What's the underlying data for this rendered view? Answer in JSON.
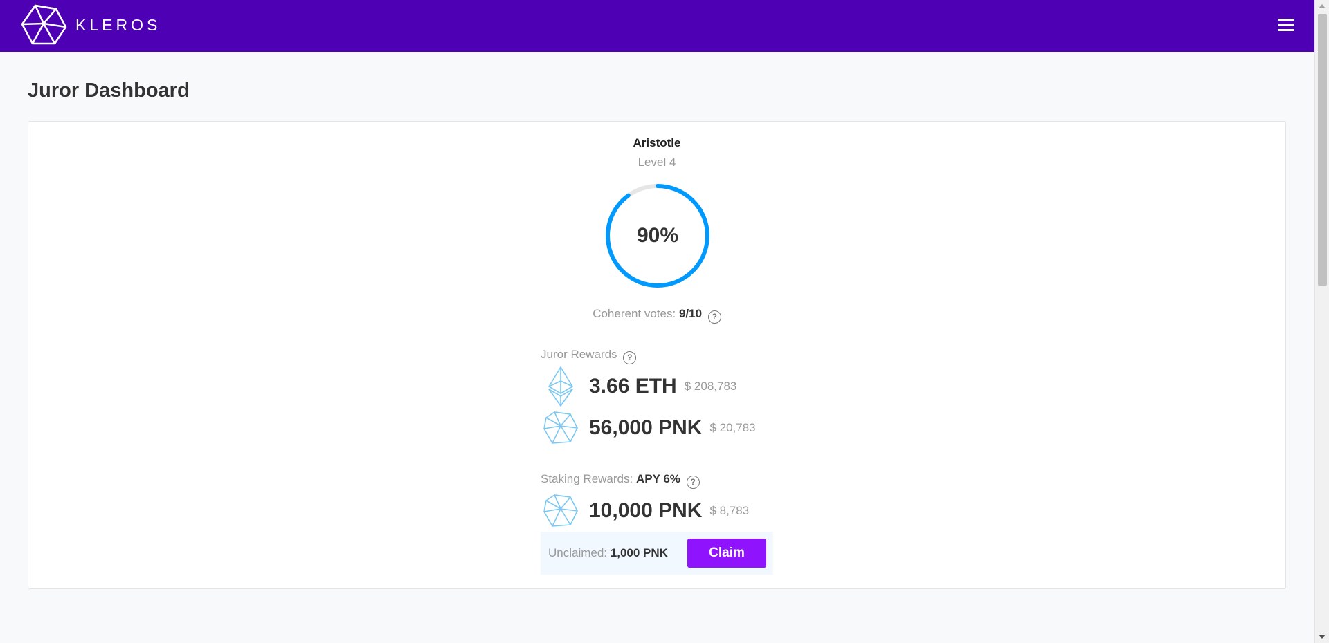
{
  "app": {
    "brand": "KLEROS",
    "logo_icon": "kleros-logo-icon",
    "menu_icon": "hamburger-menu-icon",
    "accent_color": "#4d00b4",
    "button_color": "#9013fe",
    "ring_color": "#009aff"
  },
  "page": {
    "title": "Juror Dashboard"
  },
  "juror": {
    "name": "Aristotle",
    "level": "Level 4",
    "coherence_fraction": 0.9,
    "coherence_percent": "90%",
    "coherent_label": "Coherent votes:",
    "coherent_value": "9/10"
  },
  "juror_rewards": {
    "label": "Juror Rewards",
    "items": [
      {
        "icon": "ethereum-icon",
        "amount": "3.66 ETH",
        "usd": "$ 208,783"
      },
      {
        "icon": "pinakion-icon",
        "amount": "56,000 PNK",
        "usd": "$ 20,783"
      }
    ]
  },
  "staking_rewards": {
    "label": "Staking Rewards:",
    "apy": "APY 6%",
    "item": {
      "icon": "pinakion-icon",
      "amount": "10,000 PNK",
      "usd": "$ 8,783"
    },
    "unclaimed_label": "Unclaimed:",
    "unclaimed_value": "1,000 PNK",
    "claim_label": "Claim"
  },
  "help_glyph": "?"
}
